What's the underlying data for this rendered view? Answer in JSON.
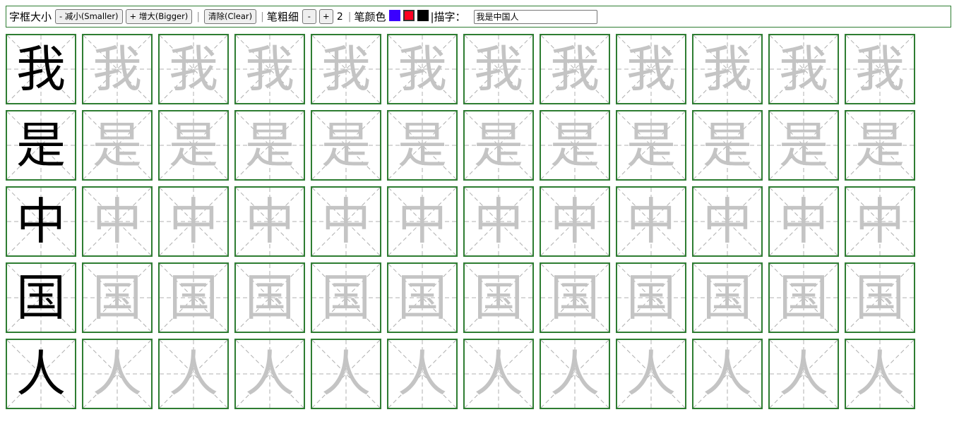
{
  "toolbar": {
    "box_size_label": "字框大小",
    "smaller_label": "- 减小(Smaller)",
    "bigger_label": "+ 增大(Bigger)",
    "separator": "|",
    "clear_label": "清除(Clear)",
    "stroke_width_label": "笔粗细",
    "width_minus": "-",
    "width_plus": "+",
    "stroke_width_value": "2",
    "pen_color_label": "笔颜色",
    "colors": [
      {
        "name": "blue",
        "hex": "#3a00ff"
      },
      {
        "name": "red",
        "hex": "#ff0022"
      },
      {
        "name": "black",
        "hex": "#000000"
      }
    ],
    "selected_color": "red",
    "trace_label": "|描字：",
    "trace_text": "我是中国人"
  },
  "grid": {
    "columns": 12,
    "model_color": "#000000",
    "trace_color": "#c4c4c4",
    "border_color": "#2e7d32",
    "guide_color": "#b0b0b0",
    "rows": [
      "我",
      "是",
      "中",
      "国",
      "人"
    ]
  }
}
